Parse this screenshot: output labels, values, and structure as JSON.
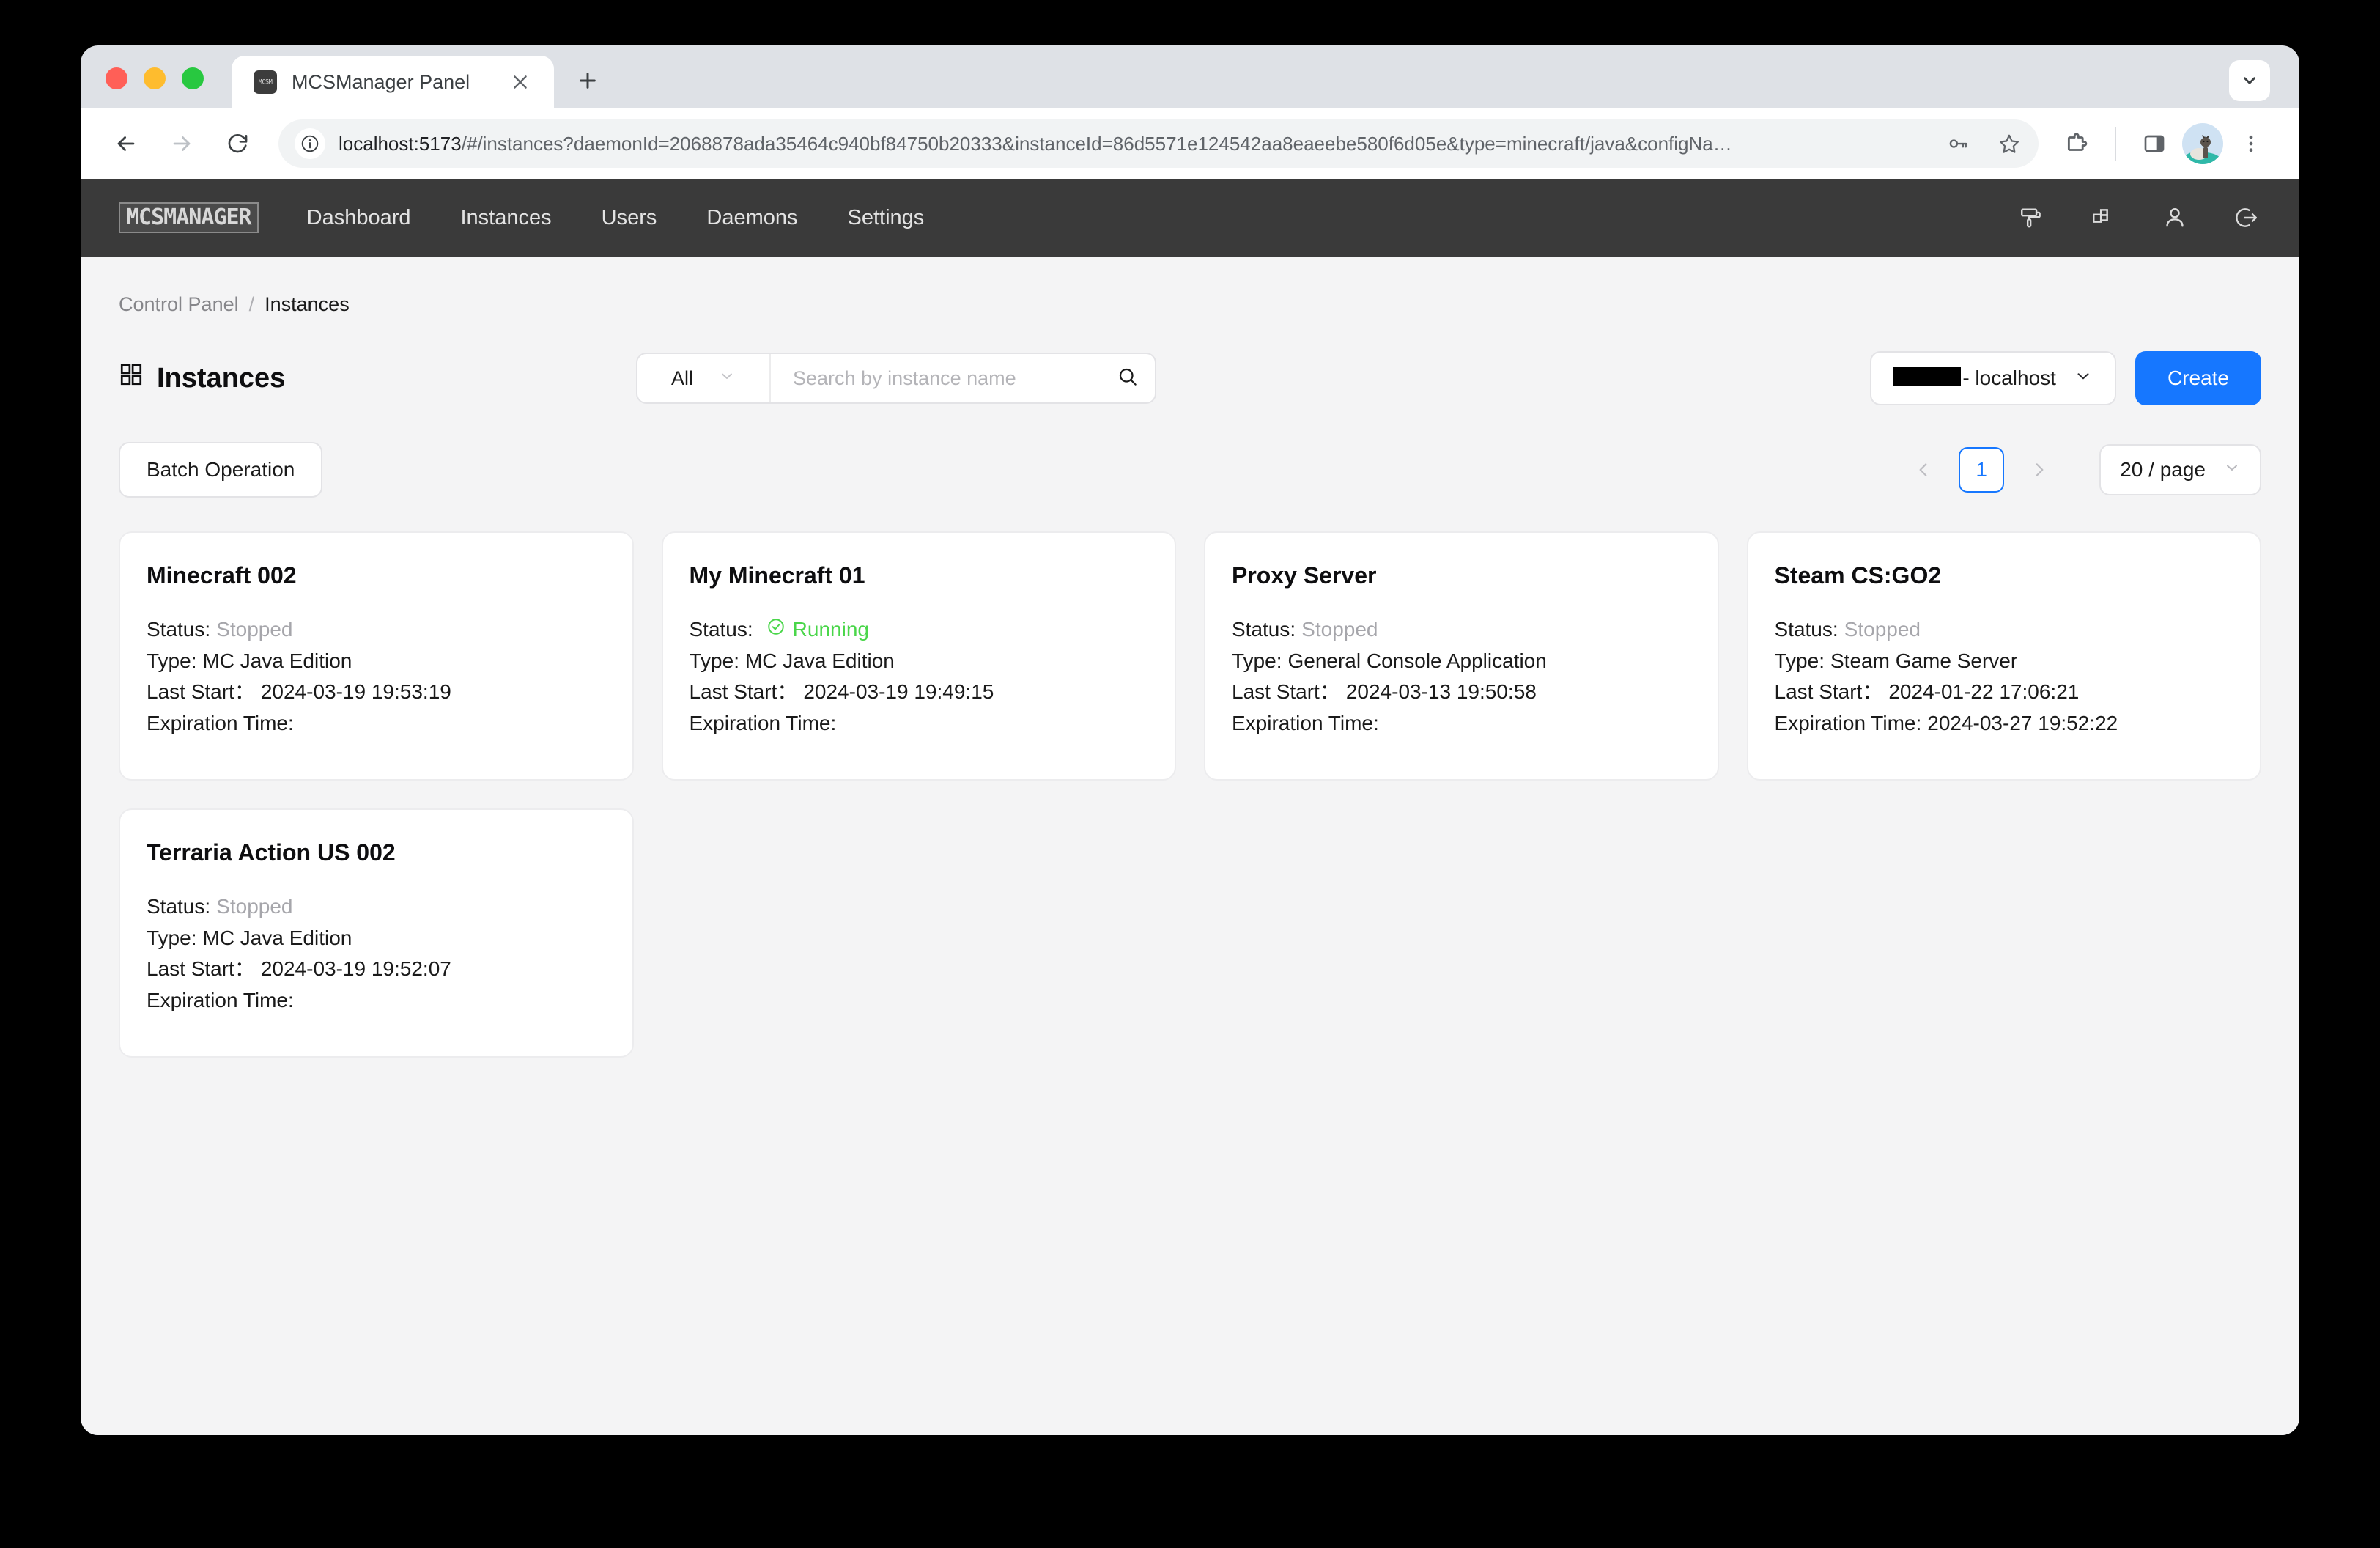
{
  "browser": {
    "tab": {
      "title": "MCSManager Panel",
      "favicon_label": "MCSM",
      "favicon_icon": "mcsmanager-favicon",
      "close_icon": "close-icon"
    },
    "new_tab_icon": "plus-icon",
    "tab_search_icon": "chevron-down-icon",
    "back_icon": "arrow-left-icon",
    "forward_icon": "arrow-right-icon",
    "reload_icon": "reload-icon",
    "site_info_icon": "info-icon",
    "url_host": "localhost:5173",
    "url_rest": "/#/instances?daemonId=2068878ada35464c940bf84750b20333&instanceId=86d5571e124542aa8eaeebe580f6d05e&type=minecraft/java&configNa…",
    "password_icon": "key-icon",
    "bookmark_icon": "star-icon",
    "extensions_icon": "puzzle-piece-icon",
    "side_panel_icon": "side-panel-icon",
    "profile_icon": "avatar-cat-icon",
    "menu_icon": "kebab-menu-icon"
  },
  "app": {
    "logo": "MCSMANAGER",
    "nav": [
      {
        "label": "Dashboard"
      },
      {
        "label": "Instances"
      },
      {
        "label": "Users"
      },
      {
        "label": "Daemons"
      },
      {
        "label": "Settings"
      }
    ],
    "header_icons": [
      {
        "name": "paint-roller-icon"
      },
      {
        "name": "layout-blocks-icon"
      },
      {
        "name": "user-icon"
      },
      {
        "name": "logout-icon"
      }
    ]
  },
  "breadcrumb": {
    "root": "Control Panel",
    "separator": "/",
    "current": "Instances"
  },
  "page": {
    "title": "Instances",
    "title_icon": "grid-icon"
  },
  "filters": {
    "type_filter": "All",
    "type_filter_caret": "chevron-down-icon",
    "search_placeholder": "Search by instance name",
    "search_value": "",
    "search_icon": "search-icon"
  },
  "node_selector": {
    "label": "- localhost",
    "caret": "chevron-down-icon"
  },
  "create_button": {
    "label": "Create"
  },
  "batch_button": {
    "label": "Batch Operation"
  },
  "pagination": {
    "prev_icon": "chevron-left-icon",
    "next_icon": "chevron-right-icon",
    "current_page": "1",
    "per_page": "20 / page",
    "per_page_caret": "chevron-down-icon"
  },
  "labels": {
    "status": "Status:",
    "type": "Type:",
    "last_start": "Last Start：",
    "expiration": "Expiration Time:"
  },
  "instances": [
    {
      "name": "Minecraft 002",
      "status": "Stopped",
      "status_state": "stopped",
      "type": "MC Java Edition",
      "last_start": "2024-03-19 19:53:19",
      "expiration": ""
    },
    {
      "name": "My Minecraft 01",
      "status": "Running",
      "status_state": "running",
      "status_icon": "check-circle-icon",
      "type": "MC Java Edition",
      "last_start": "2024-03-19 19:49:15",
      "expiration": ""
    },
    {
      "name": "Proxy Server",
      "status": "Stopped",
      "status_state": "stopped",
      "type": "General Console Application",
      "last_start": "2024-03-13 19:50:58",
      "expiration": ""
    },
    {
      "name": "Steam CS:GO2",
      "status": "Stopped",
      "status_state": "stopped",
      "type": "Steam Game Server",
      "last_start": "2024-01-22 17:06:21",
      "expiration": "2024-03-27 19:52:22"
    },
    {
      "name": "Terraria Action US 002",
      "status": "Stopped",
      "status_state": "stopped",
      "type": "MC Java Edition",
      "last_start": "2024-03-19 19:52:07",
      "expiration": ""
    }
  ],
  "colors": {
    "accent": "#1677ff",
    "running": "#4ad64a",
    "header_bg": "#3a3a3a",
    "page_bg": "#f4f4f5"
  }
}
